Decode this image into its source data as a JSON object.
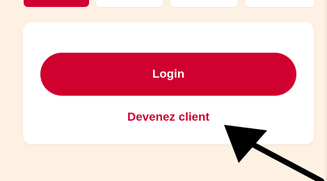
{
  "tabs": {
    "active_index": 0,
    "count": 4
  },
  "auth_card": {
    "login_label": "Login",
    "register_label": "Devenez client"
  },
  "colors": {
    "brand_red": "#d0002f",
    "page_background": "#fdf1e3",
    "card_background": "#ffffff",
    "annotation_arrow": "#000000"
  },
  "annotation": {
    "icon": "black-arrow-icon"
  }
}
